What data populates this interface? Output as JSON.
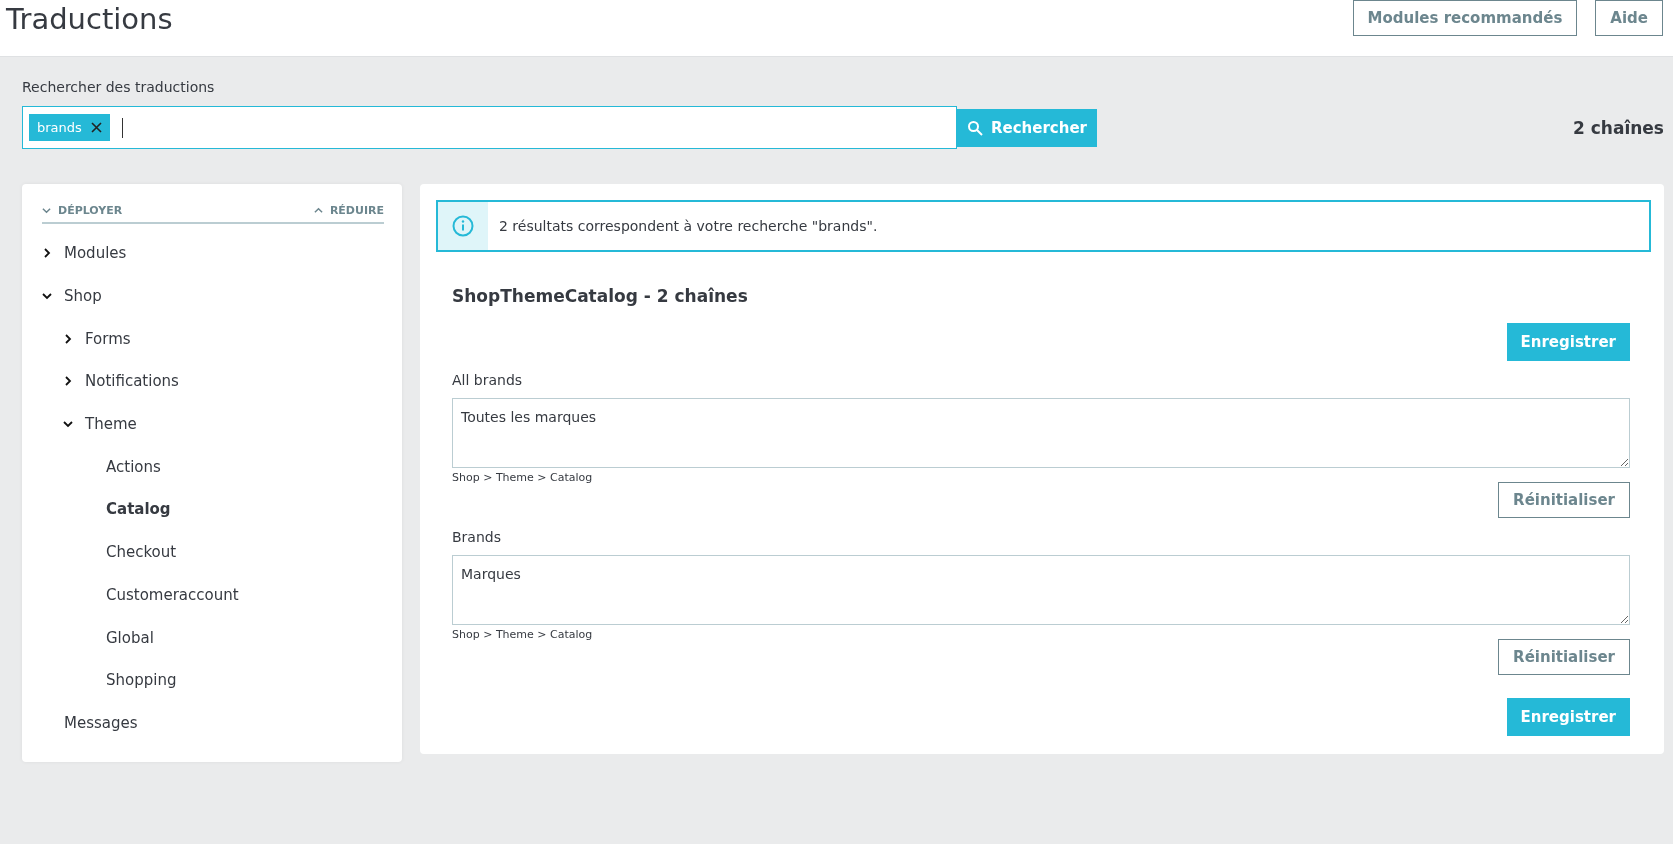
{
  "page": {
    "title": "Traductions"
  },
  "header_buttons": [
    "Modules recommandés",
    "Aide"
  ],
  "search": {
    "label": "Rechercher des traductions",
    "tags": [
      "brands"
    ],
    "button": "Rechercher",
    "count": "2 chaînes"
  },
  "tree": {
    "expand_all": "DÉPLOYER",
    "collapse_all": "RÉDUIRE",
    "items": [
      {
        "label": "Modules",
        "expanded": false,
        "selected": false
      },
      {
        "label": "Shop",
        "expanded": true,
        "selected": false,
        "children": [
          {
            "label": "Forms",
            "expanded": false,
            "selected": false
          },
          {
            "label": "Notifications",
            "expanded": false,
            "selected": false
          },
          {
            "label": "Theme",
            "expanded": true,
            "selected": false,
            "children": [
              {
                "label": "Actions",
                "selected": false
              },
              {
                "label": "Catalog",
                "selected": true
              },
              {
                "label": "Checkout",
                "selected": false
              },
              {
                "label": "Customeraccount",
                "selected": false
              },
              {
                "label": "Global",
                "selected": false
              },
              {
                "label": "Shopping",
                "selected": false
              }
            ]
          }
        ]
      },
      {
        "label": "Messages",
        "selected": false
      }
    ]
  },
  "results": {
    "info": "2 résultats correspondent à votre recherche \"brands\".",
    "domain_title": "ShopThemeCatalog - 2 chaînes",
    "save_button": "Enregistrer",
    "entries": [
      {
        "source": "All brands",
        "value": "Toutes les marques",
        "path": "Shop > Theme > Catalog",
        "reset_button": "Réinitialiser"
      },
      {
        "source": "Brands",
        "value": "Marques",
        "path": "Shop > Theme > Catalog",
        "reset_button": "Réinitialiser"
      }
    ],
    "save_button_bottom": "Enregistrer"
  }
}
